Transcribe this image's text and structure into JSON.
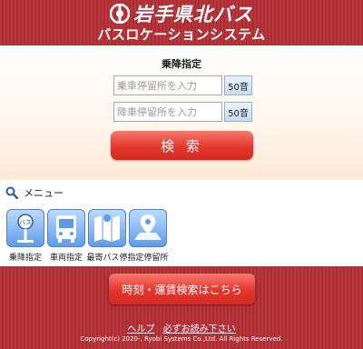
{
  "header": {
    "brand": "岩手県北バス",
    "subtitle": "バスロケーションシステム"
  },
  "search": {
    "title": "乗降指定",
    "board_placeholder": "乗車停留所を入力",
    "alight_placeholder": "降車停留所を入力",
    "kana_label": "50音",
    "search_label": "検 索"
  },
  "menu": {
    "heading": "メニュー",
    "items": [
      {
        "label": "乗降指定",
        "icon": "bus-stop-icon"
      },
      {
        "label": "車両指定",
        "icon": "bus-icon"
      },
      {
        "label": "最寄バス停",
        "icon": "map-icon"
      },
      {
        "label": "指定停留所",
        "icon": "map-pin-icon"
      }
    ]
  },
  "footer": {
    "timetable_label": "時刻・運賃検索はこちら",
    "help_link": "ヘルプ",
    "notice_link": "必ずお読み下さい",
    "copyright": "Copyright(c) 2020-, Ryobi Systems Co.,Ltd. All Rights Reserved."
  },
  "colors": {
    "header_red": "#b8363c",
    "button_red": "#e4362d",
    "tile_blue": "#5c9be5"
  }
}
